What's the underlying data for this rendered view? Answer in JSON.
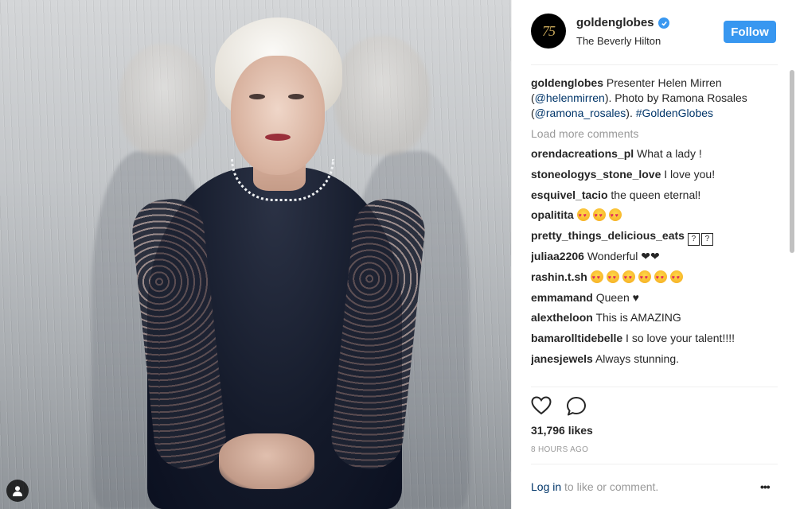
{
  "post": {
    "account": {
      "avatar_text": "75",
      "username": "goldenglobes",
      "verified": true,
      "location": "The Beverly Hilton",
      "follow_label": "Follow"
    },
    "caption": {
      "username": "goldenglobes",
      "text_1": " Presenter Helen Mirren (",
      "mention_1": "@helenmirren",
      "text_2": "). Photo by Ramona Rosales (",
      "mention_2": "@ramona_rosales",
      "text_3": "). ",
      "hashtag": "#GoldenGlobes"
    },
    "load_more": "Load more comments",
    "comments": [
      {
        "user": "orendacreations_pl",
        "text": "What a lady !"
      },
      {
        "user": "stoneologys_stone_love",
        "text": "I love you!"
      },
      {
        "user": "esquivel_tacio",
        "text": "the queen eternal!"
      },
      {
        "user": "opalitita",
        "text": "",
        "emoji_count": 3
      },
      {
        "user": "pretty_things_delicious_eats",
        "text": "",
        "box_glyphs": [
          "?",
          "?"
        ]
      },
      {
        "user": "juliaa2206",
        "text": "Wonderful ❤❤"
      },
      {
        "user": "rashin.t.sh",
        "text": "",
        "emoji_count": 6
      },
      {
        "user": "emmamand",
        "text": "Queen ♥"
      },
      {
        "user": "alextheloon",
        "text": "This is AMAZING"
      },
      {
        "user": "bamarolltidebelle",
        "text": "I so love your talent!!!!"
      },
      {
        "user": "janesjewels",
        "text": "Always stunning."
      }
    ],
    "likes": "31,796 likes",
    "time": "8 HOURS AGO",
    "login": {
      "link": "Log in",
      "rest": " to like or comment."
    },
    "more_options": "•••",
    "icons": {
      "like": "heart-icon",
      "comment": "comment-icon",
      "tag": "user-tag-icon",
      "verified": "verified-badge-icon"
    },
    "colors": {
      "accent": "#3897f0",
      "link": "#003569",
      "muted": "#999999"
    }
  }
}
